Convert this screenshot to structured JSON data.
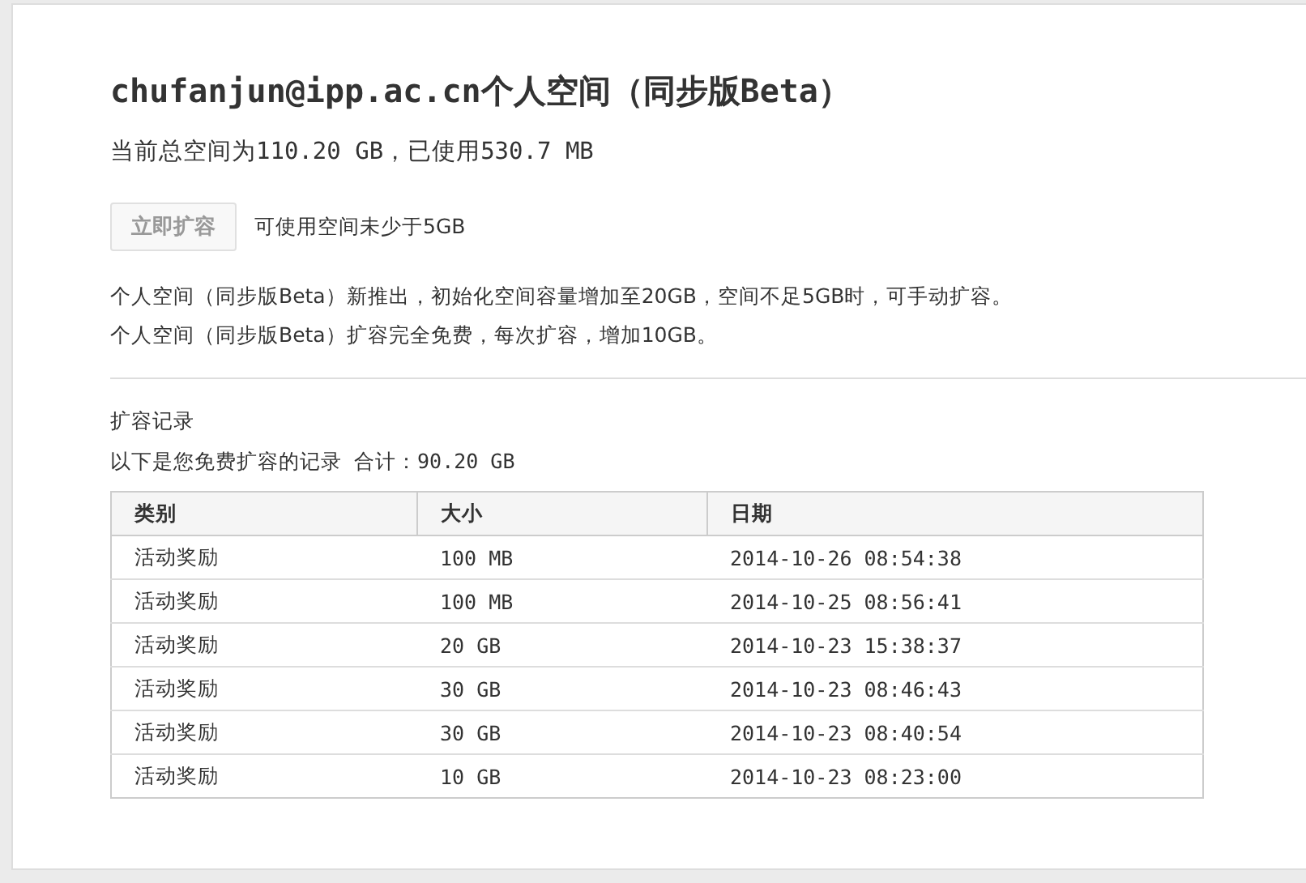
{
  "title": "chufanjun@ipp.ac.cn个人空间（同步版Beta）",
  "usage": "当前总空间为110.20 GB，已使用530.7 MB",
  "expand_button": {
    "label": "立即扩容",
    "disabled": true
  },
  "expand_hint": "可使用空间未少于5GB",
  "notes": [
    "个人空间（同步版Beta）新推出，初始化空间容量增加至20GB，空间不足5GB时，可手动扩容。",
    "个人空间（同步版Beta）扩容完全免费，每次扩容，增加10GB。"
  ],
  "records": {
    "heading": "扩容记录",
    "summary": "以下是您免费扩容的记录 合计：90.20 GB",
    "table": {
      "columns": [
        "类别",
        "大小",
        "日期"
      ],
      "rows": [
        [
          "活动奖励",
          "100 MB",
          "2014-10-26 08:54:38"
        ],
        [
          "活动奖励",
          "100 MB",
          "2014-10-25 08:56:41"
        ],
        [
          "活动奖励",
          "20 GB",
          "2014-10-23 15:38:37"
        ],
        [
          "活动奖励",
          "30 GB",
          "2014-10-23 08:46:43"
        ],
        [
          "活动奖励",
          "30 GB",
          "2014-10-23 08:40:54"
        ],
        [
          "活动奖励",
          "10 GB",
          "2014-10-23 08:23:00"
        ]
      ]
    }
  }
}
